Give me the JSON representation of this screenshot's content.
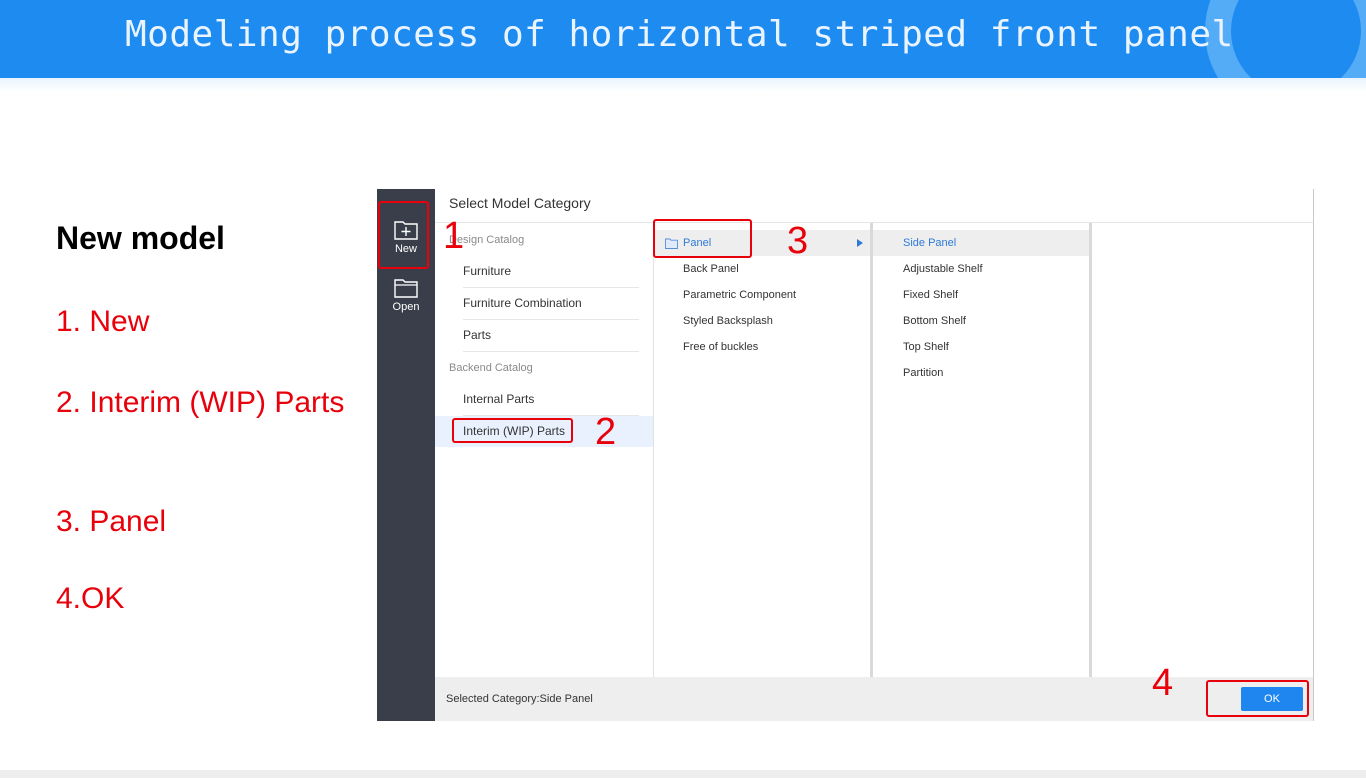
{
  "banner": {
    "title": "Modeling process of horizontal striped front panel"
  },
  "left_panel": {
    "heading": "New model",
    "steps": [
      "1. New",
      "2. Interim (WIP) Parts",
      "3. Panel",
      "4.OK"
    ]
  },
  "dialog": {
    "title": "Select Model Category",
    "sidebar": {
      "new_label": "New",
      "open_label": "Open"
    },
    "design_catalog": {
      "label": "Design Catalog",
      "items": [
        "Furniture",
        "Furniture Combination",
        "Parts"
      ]
    },
    "backend_catalog": {
      "label": "Backend Catalog",
      "items": [
        "Internal Parts",
        "Interim (WIP) Parts"
      ]
    },
    "panel_types": [
      "Panel",
      "Back Panel",
      "Parametric Component",
      "Styled Backsplash",
      "Free of buckles"
    ],
    "sub_types": [
      "Side Panel",
      "Adjustable Shelf",
      "Fixed Shelf",
      "Bottom Shelf",
      "Top Shelf",
      "Partition"
    ],
    "footer": {
      "selected_category": "Selected Category:Side Panel",
      "ok_label": "OK"
    }
  },
  "annotations": {
    "n1": "1",
    "n2": "2",
    "n3": "3",
    "n4": "4"
  },
  "colors": {
    "banner": "#1e8bf1",
    "annotation": "#e8000b",
    "accent": "#1f86f0",
    "sidebar": "#3a3e4a"
  }
}
